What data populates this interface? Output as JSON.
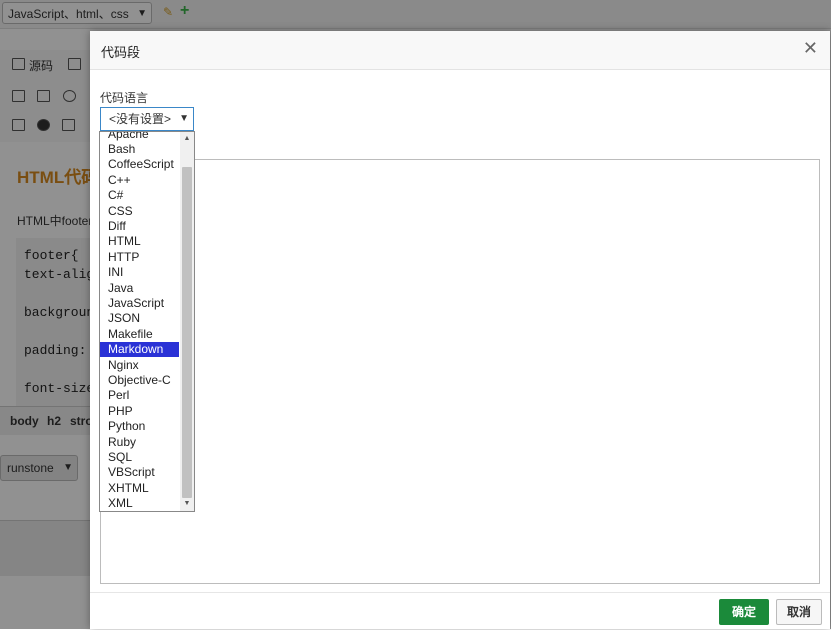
{
  "background": {
    "tag_select": "JavaScript、html、css",
    "toolbar_source": "源码",
    "heading": "HTML代码",
    "paragraph": "HTML中footer",
    "code_lines": [
      "footer{",
      "text-align",
      "",
      "background",
      "",
      "padding:",
      "",
      "font-size"
    ],
    "path": [
      "body",
      "h2",
      "stro"
    ],
    "user_select": "runstone"
  },
  "dialog": {
    "title": "代码段",
    "language_label": "代码语言",
    "language_value": "<没有设置>",
    "ok": "确定",
    "cancel": "取消"
  },
  "dropdown": {
    "options": [
      "Apache",
      "Bash",
      "CoffeeScript",
      "C++",
      "C#",
      "CSS",
      "Diff",
      "HTML",
      "HTTP",
      "INI",
      "Java",
      "JavaScript",
      "JSON",
      "Makefile",
      "Markdown",
      "Nginx",
      "Objective-C",
      "Perl",
      "PHP",
      "Python",
      "Ruby",
      "SQL",
      "VBScript",
      "XHTML",
      "XML"
    ],
    "selected": "Markdown"
  },
  "colors": {
    "ok_button": "#1b8a3a",
    "selected_option": "#2a32d6",
    "heading": "#d6891f",
    "select_focus": "#3a87c8"
  }
}
